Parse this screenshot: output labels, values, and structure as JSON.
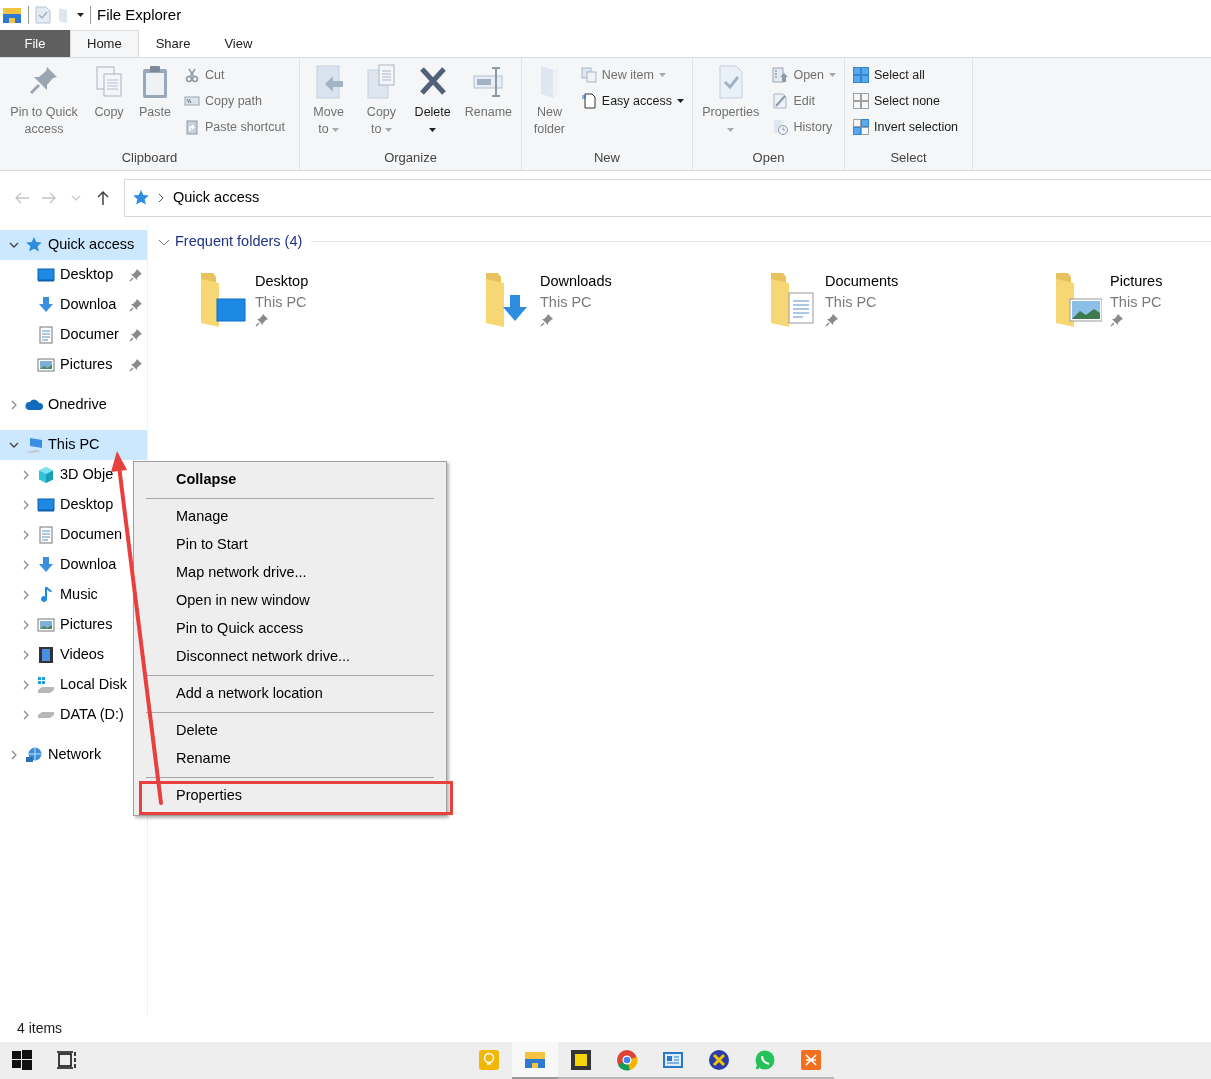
{
  "title_bar": {
    "title": "File Explorer"
  },
  "ribbon_tabs": [
    {
      "label": "File",
      "kind": "file",
      "selected": false
    },
    {
      "label": "Home",
      "kind": "tab",
      "selected": true
    },
    {
      "label": "Share",
      "kind": "tab",
      "selected": false
    },
    {
      "label": "View",
      "kind": "tab",
      "selected": false
    }
  ],
  "ribbon_groups": [
    {
      "label": "Clipboard",
      "items": [
        {
          "kind": "large",
          "label": "Pin to Quick access",
          "disabled": true
        },
        {
          "kind": "large",
          "label": "Copy",
          "disabled": true
        },
        {
          "kind": "large",
          "label": "Paste",
          "disabled": true
        },
        {
          "kind": "small",
          "label": "Cut",
          "disabled": true
        },
        {
          "kind": "small",
          "label": "Copy path",
          "disabled": true
        },
        {
          "kind": "small",
          "label": "Paste shortcut",
          "disabled": true
        }
      ]
    },
    {
      "label": "Organize",
      "items": [
        {
          "kind": "large",
          "label": "Move to",
          "disabled": true,
          "dropdown": true
        },
        {
          "kind": "large",
          "label": "Copy to",
          "disabled": true,
          "dropdown": true
        },
        {
          "kind": "large",
          "label": "Delete",
          "disabled": false,
          "dropdown": true
        },
        {
          "kind": "large",
          "label": "Rename",
          "disabled": true
        }
      ]
    },
    {
      "label": "New",
      "items": [
        {
          "kind": "large",
          "label": "New folder",
          "disabled": true
        },
        {
          "kind": "small",
          "label": "New item",
          "disabled": true,
          "dropdown": true
        },
        {
          "kind": "small",
          "label": "Easy access",
          "disabled": false,
          "dropdown": true
        }
      ]
    },
    {
      "label": "Open",
      "items": [
        {
          "kind": "large",
          "label": "Properties",
          "disabled": true,
          "dropdown": true
        },
        {
          "kind": "small",
          "label": "Open",
          "disabled": true,
          "dropdown": true
        },
        {
          "kind": "small",
          "label": "Edit",
          "disabled": true
        },
        {
          "kind": "small",
          "label": "History",
          "disabled": true
        }
      ]
    },
    {
      "label": "Select",
      "items": [
        {
          "kind": "small",
          "label": "Select all",
          "disabled": false
        },
        {
          "kind": "small",
          "label": "Select none",
          "disabled": false
        },
        {
          "kind": "small",
          "label": "Invert selection",
          "disabled": false
        }
      ]
    }
  ],
  "address_bar": {
    "nav_buttons": [
      {
        "kind": "back",
        "disabled": true
      },
      {
        "kind": "forward",
        "disabled": true
      },
      {
        "kind": "recent",
        "disabled": true
      },
      {
        "kind": "up",
        "disabled": false
      }
    ],
    "path": [
      "Quick access"
    ]
  },
  "sidebar": {
    "items": [
      {
        "label": "Quick access",
        "expanded": true,
        "selected": true,
        "children": [
          {
            "label": "Desktop",
            "pinned": true
          },
          {
            "label": "Downloa",
            "pinned": true
          },
          {
            "label": "Documer",
            "pinned": true
          },
          {
            "label": "Pictures",
            "pinned": true
          }
        ]
      },
      {
        "label": "Onedrive",
        "expanded": false,
        "selected": false
      },
      {
        "label": "This PC",
        "expanded": true,
        "selected": true,
        "children": [
          {
            "label": "3D Obje",
            "expanded": false
          },
          {
            "label": "Desktop",
            "expanded": false
          },
          {
            "label": "Documen",
            "expanded": false
          },
          {
            "label": "Downloa",
            "expanded": false
          },
          {
            "label": "Music",
            "expanded": false
          },
          {
            "label": "Pictures",
            "expanded": false
          },
          {
            "label": "Videos",
            "expanded": false
          },
          {
            "label": "Local Disk",
            "expanded": false
          },
          {
            "label": "DATA (D:)",
            "expanded": false
          }
        ]
      },
      {
        "label": "Network",
        "expanded": false,
        "selected": false
      }
    ]
  },
  "content": {
    "section": {
      "label": "Frequent folders (4)",
      "expanded": true
    },
    "folders": [
      {
        "name": "Desktop",
        "location": "This PC",
        "pinned": true
      },
      {
        "name": "Downloads",
        "location": "This PC",
        "pinned": true
      },
      {
        "name": "Documents",
        "location": "This PC",
        "pinned": true
      },
      {
        "name": "Pictures",
        "location": "This PC",
        "pinned": true
      }
    ]
  },
  "context_menu": {
    "groups": [
      [
        {
          "label": "Collapse",
          "bold": true
        }
      ],
      [
        {
          "label": "Manage"
        },
        {
          "label": "Pin to Start"
        },
        {
          "label": "Map network drive..."
        },
        {
          "label": "Open in new window"
        },
        {
          "label": "Pin to Quick access"
        },
        {
          "label": "Disconnect network drive..."
        }
      ],
      [
        {
          "label": "Add a network location"
        }
      ],
      [
        {
          "label": "Delete"
        },
        {
          "label": "Rename"
        }
      ],
      [
        {
          "label": "Properties",
          "annotated": true
        }
      ]
    ]
  },
  "status_bar": {
    "text": "4 items"
  },
  "taskbar": {
    "apps": [
      {
        "running": false,
        "active": false
      },
      {
        "running": true,
        "active": true
      },
      {
        "running": true,
        "active": false
      },
      {
        "running": true,
        "active": false
      },
      {
        "running": true,
        "active": false
      },
      {
        "running": true,
        "active": false
      },
      {
        "running": true,
        "active": false
      },
      {
        "running": true,
        "active": false
      }
    ]
  }
}
